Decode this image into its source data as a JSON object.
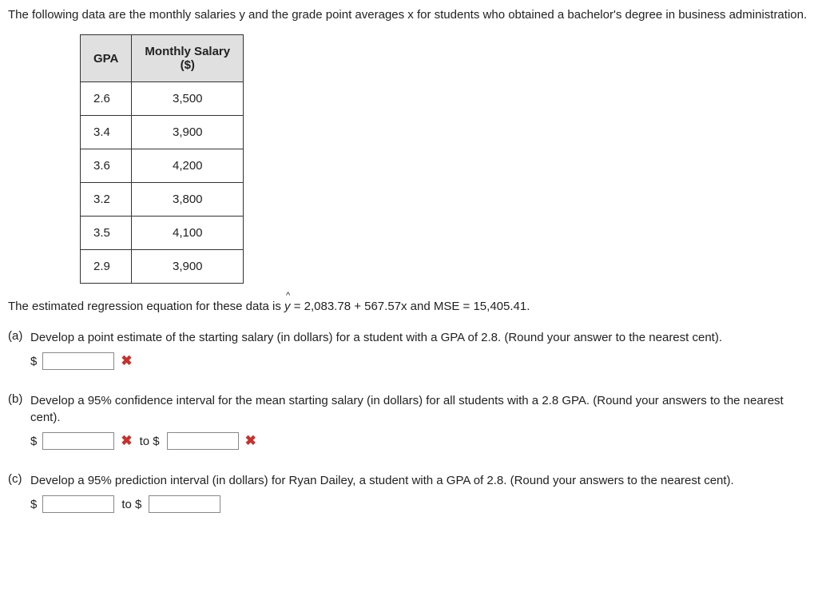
{
  "intro": "The following data are the monthly salaries y and the grade point averages x for students who obtained a bachelor's degree in business administration.",
  "table": {
    "headers": {
      "col1": "GPA",
      "col2_line1": "Monthly Salary",
      "col2_line2": "($)"
    },
    "rows": [
      {
        "gpa": "2.6",
        "salary": "3,500"
      },
      {
        "gpa": "3.4",
        "salary": "3,900"
      },
      {
        "gpa": "3.6",
        "salary": "4,200"
      },
      {
        "gpa": "3.2",
        "salary": "3,800"
      },
      {
        "gpa": "3.5",
        "salary": "4,100"
      },
      {
        "gpa": "2.9",
        "salary": "3,900"
      }
    ]
  },
  "regression_prefix": "The estimated regression equation for these data is ",
  "y_var": "y",
  "regression_suffix": " = 2,083.78 + 567.57x and MSE = 15,405.41.",
  "qa": {
    "label": "(a)",
    "text": "Develop a point estimate of the starting salary (in dollars) for a student with a GPA of 2.8. (Round your answer to the nearest cent).",
    "dollar": "$"
  },
  "qb": {
    "label": "(b)",
    "text": "Develop a 95% confidence interval for the mean starting salary (in dollars) for all students with a 2.8 GPA. (Round your answers to the nearest cent).",
    "dollar": "$",
    "to": "to $"
  },
  "qc": {
    "label": "(c)",
    "text": "Develop a 95% prediction interval (in dollars) for Ryan Dailey, a student with a GPA of 2.8. (Round your answers to the nearest cent).",
    "dollar": "$",
    "to": "to $"
  }
}
